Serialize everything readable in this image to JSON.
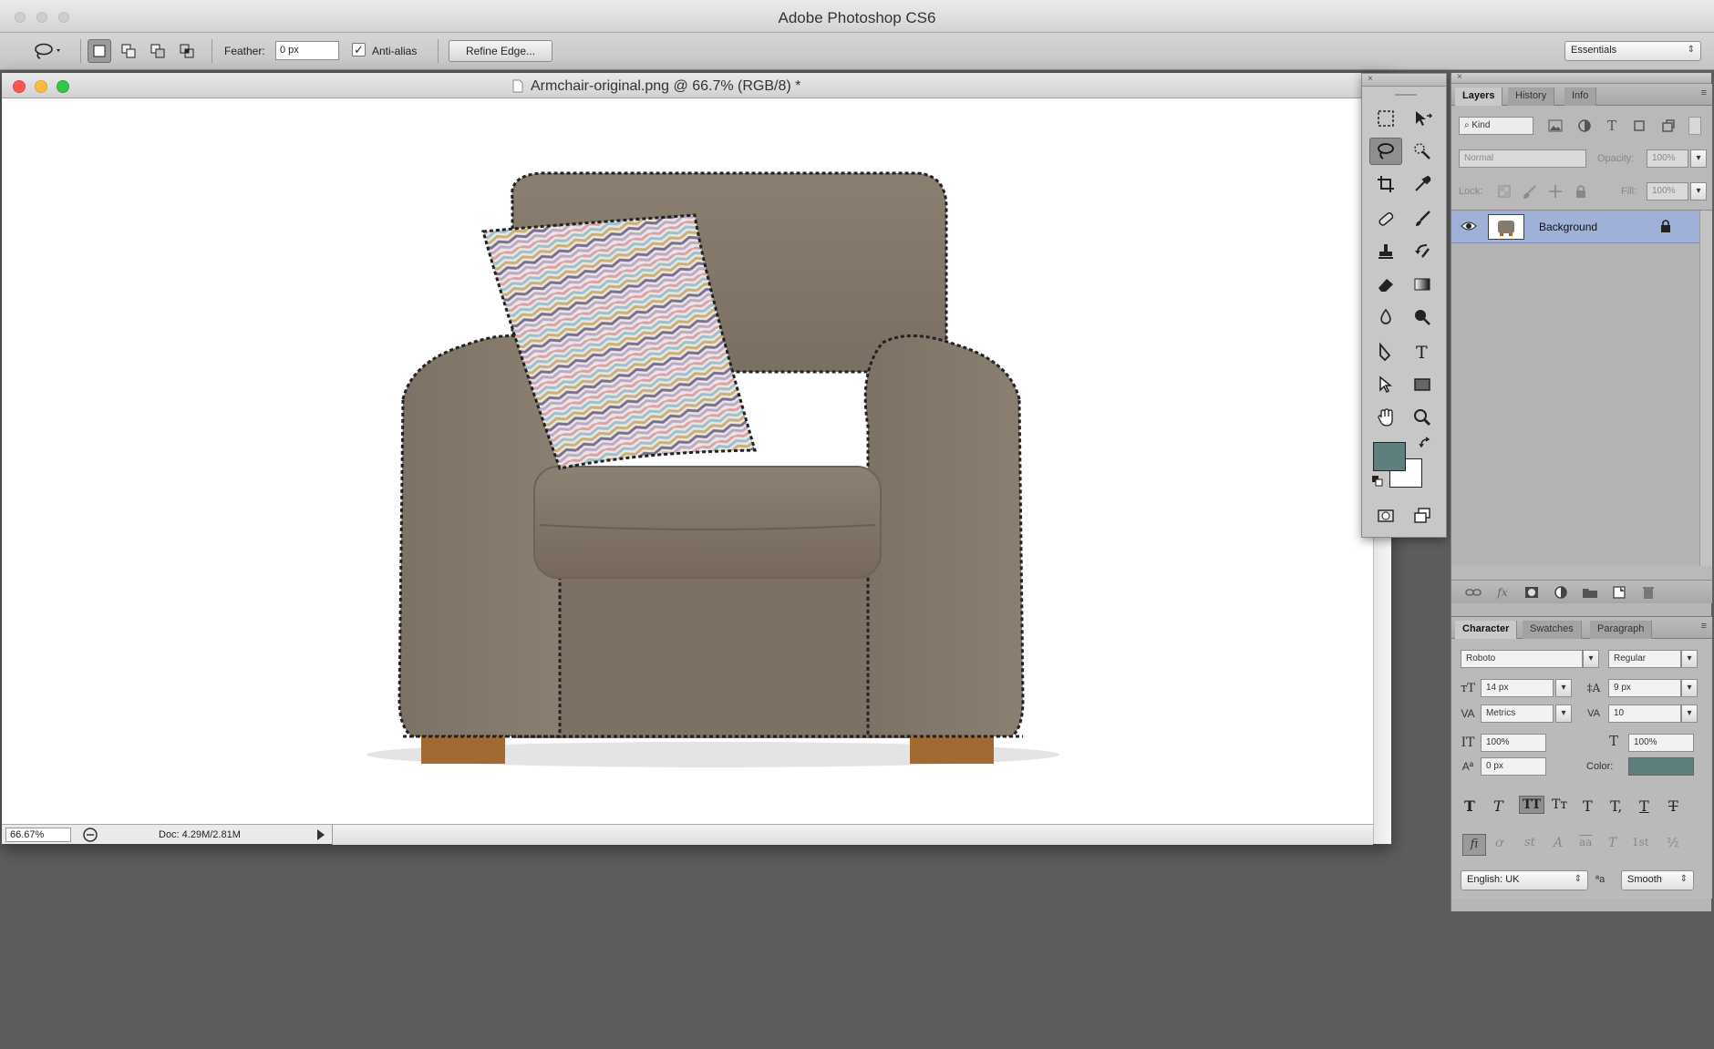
{
  "app": {
    "title": "Adobe Photoshop CS6"
  },
  "options_bar": {
    "feather_label": "Feather:",
    "feather_value": "0 px",
    "antialias_label": "Anti-alias",
    "antialias_checked": true,
    "refine_edge_label": "Refine Edge...",
    "workspace": "Essentials"
  },
  "document": {
    "title": "Armchair-original.png @ 66.7% (RGB/8) *",
    "zoom": "66.67%",
    "doc_size": "Doc: 4.29M/2.81M"
  },
  "tools": {
    "foreground_color": "#5f7f7f",
    "background_color": "#ffffff"
  },
  "layers_panel": {
    "tabs": [
      "Layers",
      "History",
      "Info"
    ],
    "kind_filter": "Kind",
    "blend_mode": "Normal",
    "opacity_label": "Opacity:",
    "opacity_value": "100%",
    "lock_label": "Lock:",
    "fill_label": "Fill:",
    "fill_value": "100%",
    "layers": [
      {
        "name": "Background",
        "visible": true,
        "locked": true
      }
    ]
  },
  "character_panel": {
    "tabs": [
      "Character",
      "Swatches",
      "Paragraph"
    ],
    "font_family": "Roboto",
    "font_style": "Regular",
    "font_size": "14 px",
    "leading": "9 px",
    "kerning": "Metrics",
    "tracking": "10",
    "vertical_scale": "100%",
    "horizontal_scale": "100%",
    "baseline_shift": "0 px",
    "color_label": "Color:",
    "color_value": "#5f7f7f",
    "language": "English: UK",
    "aa_label": "ªa",
    "antialiasing": "Smooth",
    "style_buttons": [
      "T",
      "T",
      "TT",
      "Tт",
      "T",
      "T,",
      "T",
      "T"
    ],
    "opentype_buttons": [
      "fi",
      "ơ",
      "st",
      "A",
      "aa",
      "T",
      "1st",
      "½"
    ]
  }
}
